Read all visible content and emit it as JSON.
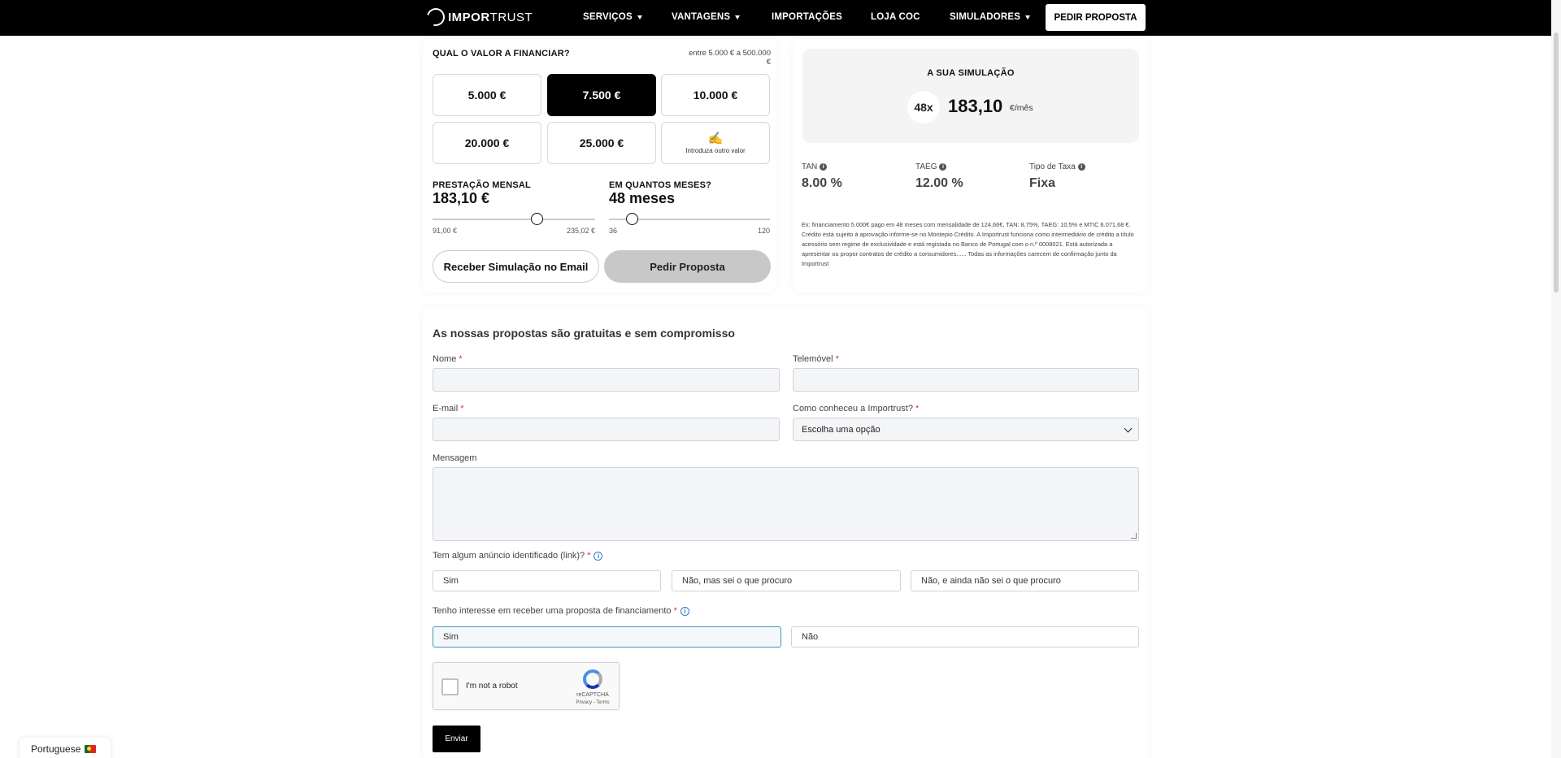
{
  "nav": {
    "logo_bold": "IMPOR",
    "logo_light": "TRUST",
    "items": [
      {
        "label": "SERVIÇOS",
        "dropdown": true
      },
      {
        "label": "VANTAGENS",
        "dropdown": true
      },
      {
        "label": "IMPORTAÇÕES",
        "dropdown": false
      },
      {
        "label": "LOJA COC",
        "dropdown": false
      },
      {
        "label": "SIMULADORES",
        "dropdown": true
      }
    ],
    "cta": "PEDIR PROPOSTA"
  },
  "calc": {
    "question": "QUAL O VALOR A FINANCIAR?",
    "range_note": "entre 5.000 € a 500.000 €",
    "amounts": [
      "5.000 €",
      "7.500 €",
      "10.000 €",
      "20.000 €",
      "25.000 €"
    ],
    "selected_amount": "7.500 €",
    "custom_icon": "✍",
    "custom_label": "Introduza outro valor",
    "monthly_label": "PRESTAÇÃO MENSAL",
    "monthly_value": "183,10 €",
    "monthly_min": "91,00 €",
    "monthly_max": "235,02 €",
    "months_label": "EM QUANTOS MESES?",
    "months_value": "48 meses",
    "months_min": "36",
    "months_max": "120",
    "months_slider_value": 48,
    "monthly_slider_value": 183.1,
    "btn_email": "Receber Simulação no Email",
    "btn_proposal": "Pedir Proposta"
  },
  "result": {
    "title": "A SUA SIMULAÇÃO",
    "installments": "48x",
    "amount": "183,10",
    "unit": "€/mês",
    "tan_label": "TAN",
    "tan_value": "8.00 %",
    "taeg_label": "TAEG",
    "taeg_value": "12.00 %",
    "rate_type_label": "Tipo de Taxa",
    "rate_type_value": "Fixa",
    "disclaimer": "Ex: financiamento 5.000€ pago em 48 meses com mensalidade de 124,66€, TAN: 8,75%, TAEG: 10,5% e MTIC 6.071,68 €. Crédito está sujeito à aprovação informe-se no Montepio Crédito. A Importrust funciona como intermediário de crédito a título acessório sem regime de exclusividade e está registada no Banco de Portugal com o n.º 0008021. Está autorizada a apresentar ou propor contratos de crédito a consumidores...... Todas as informações carecem de confirmação junto da Importrust"
  },
  "form": {
    "title": "As nossas propostas são gratuitas e sem compromisso",
    "name_label": "Nome",
    "phone_label": "Telemóvel",
    "email_label": "E-mail",
    "source_label": "Como conheceu a Importrust?",
    "source_selected": "Escolha uma opção",
    "message_label": "Mensagem",
    "ad_label": "Tem algum anúncio identificado (link)?",
    "ad_options": [
      "Sim",
      "Não, mas sei o que procuro",
      "Não, e ainda não sei o que procuro"
    ],
    "finance_label": "Tenho interesse em receber uma proposta de financiamento",
    "finance_options": [
      "Sim",
      "Não"
    ],
    "required_mark": "*",
    "captcha_text": "I'm not a robot",
    "captcha_brand": "reCAPTCHA",
    "captcha_links": "Privacy - Terms",
    "submit": "Enviar"
  },
  "language": {
    "label": "Portuguese"
  }
}
